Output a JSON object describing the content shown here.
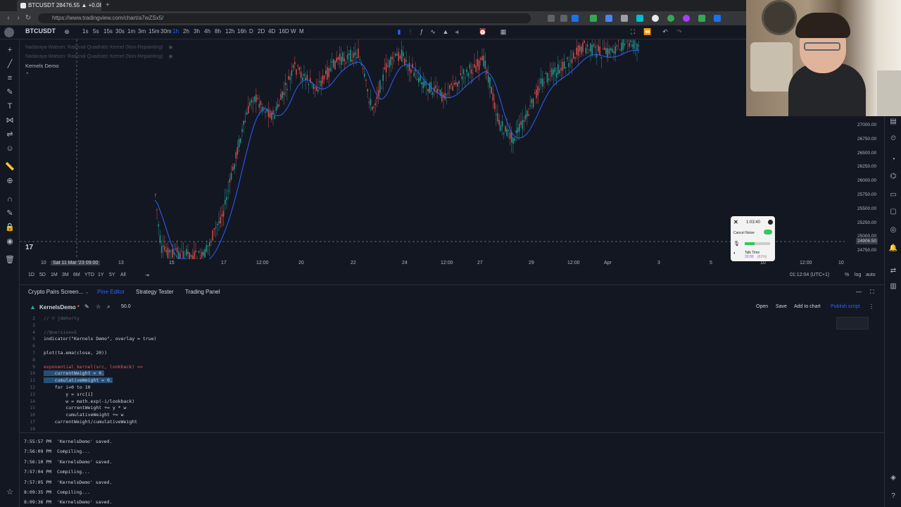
{
  "browser": {
    "tab_title": "BTCUSDT 28476.55 ▲ +0.08% M...",
    "url": "https://www.tradingview.com/chart/a7wZSx5/"
  },
  "toolbar": {
    "symbol": "BTCUSDT",
    "timeframes": [
      "1s",
      "5s",
      "15s",
      "30s",
      "1m",
      "3m",
      "15m",
      "30m",
      "1h",
      "2h",
      "3h",
      "4h",
      "8h",
      "12h",
      "16h",
      "D",
      "2D",
      "4D",
      "16D",
      "W",
      "M"
    ],
    "active_timeframe": "1h"
  },
  "chart": {
    "legend": [
      "Nadaraya-Watson: Rational Quadratic Kernel (Non-Repainting)",
      "Nadaraya-Watson: Rational Quadratic Kernel (Non-Repainting)",
      "Kernels Demo"
    ],
    "price_labels": [
      "27000.00",
      "26750.00",
      "26500.00",
      "26250.00",
      "26000.00",
      "25750.00",
      "25500.00",
      "25250.00",
      "25000.00",
      "24750.00"
    ],
    "crosshair_price": "24906.50",
    "time_labels": [
      "10",
      "13",
      "15",
      "17",
      "12:00",
      "20",
      "22",
      "24",
      "12:00",
      "27",
      "29",
      "12:00",
      "Apr",
      "3",
      "5",
      "10",
      "12:00",
      "10"
    ],
    "crosshair_time": "Sat 11 Mar '23  09:00",
    "ranges": [
      "1D",
      "5D",
      "1M",
      "3M",
      "6M",
      "YTD",
      "1Y",
      "5Y",
      "All"
    ],
    "clock": "01:12:04 (UTC+1)",
    "scale_opts": [
      "%",
      "log",
      "auto"
    ]
  },
  "panel": {
    "tabs": [
      "Crypto Pairs Screen...",
      "Pine Editor",
      "Strategy Tester",
      "Trading Panel"
    ],
    "active_tab": "Pine Editor",
    "script_name": "KernelsDemo",
    "script_version": "50.0",
    "actions": [
      "Open",
      "Save",
      "Add to chart",
      "Publish script"
    ]
  },
  "editor": {
    "lines": [
      {
        "n": "2",
        "text": "// © jdehorty"
      },
      {
        "n": "3",
        "text": ""
      },
      {
        "n": "4",
        "text": "//@version=5"
      },
      {
        "n": "5",
        "text": "indicator(\"Kernels Demo\", overlay = true)"
      },
      {
        "n": "6",
        "text": ""
      },
      {
        "n": "7",
        "text": "plot(ta.ema(close, 20))"
      },
      {
        "n": "8",
        "text": ""
      },
      {
        "n": "9",
        "text": "exponential_kernel(src, lookback) =>"
      },
      {
        "n": "10",
        "text": "    currentWeight = 0."
      },
      {
        "n": "11",
        "text": "    cumulativeWeight = 0."
      },
      {
        "n": "12",
        "text": "    for i=0 to 10"
      },
      {
        "n": "13",
        "text": "        y = src[i]"
      },
      {
        "n": "14",
        "text": "        w = math.exp(-i/lookback)"
      },
      {
        "n": "15",
        "text": "        currentWeight += y * w"
      },
      {
        "n": "16",
        "text": "        cumulativeWeight += w"
      },
      {
        "n": "17",
        "text": "    currentWeight/cumulativeWeight"
      },
      {
        "n": "18",
        "text": ""
      }
    ]
  },
  "console": {
    "lines": [
      "7:55:57 PM  'KernelsDemo' saved.",
      "7:56:09 PM  Compiling...",
      "7:56:10 PM  'KernelsDemo' saved.",
      "7:57:04 PM  Compiling...",
      "7:57:05 PM  'KernelsDemo' saved.",
      "8:09:35 PM  Compiling...",
      "8:09:36 PM  'KernelsDemo' saved."
    ]
  },
  "recorder": {
    "time": "1:03:40",
    "cancel_noise": "Cancel Noise",
    "talk_time": "Talk Time",
    "talk_value": "20:00",
    "talk_pct": "(61%)"
  },
  "colors": {
    "bg": "#131722",
    "up": "#26a69a",
    "down": "#ef5350",
    "ema": "#2962ff",
    "accent": "#2962ff"
  }
}
